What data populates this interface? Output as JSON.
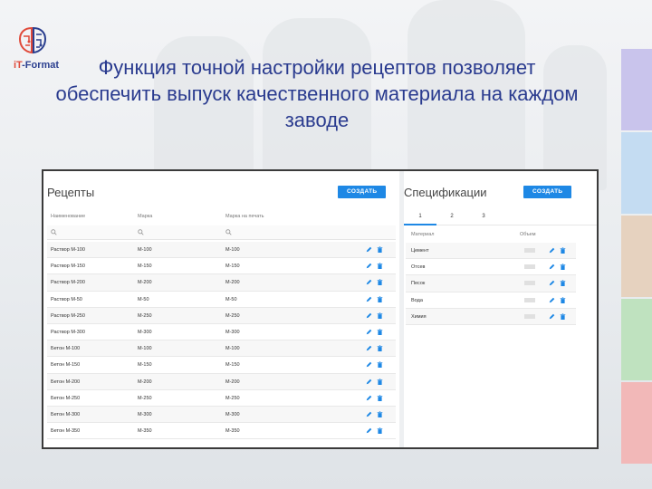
{
  "brand": {
    "logo_text_it": "iT",
    "logo_text_rest": "-Format"
  },
  "headline": "Функция точной настройки рецептов позволяет обеспечить выпуск качественного материала на каждом заводе",
  "side_bar_colors": [
    "#c9c4ec",
    "#c4dcf2",
    "#e6d2bf",
    "#bfe2bf",
    "#f2b8b8"
  ],
  "recipes": {
    "title": "Рецепты",
    "create_label": "СОЗДАТЬ",
    "columns": [
      "Наименование",
      "Марка",
      "Марка на печать"
    ],
    "rows": [
      [
        "Раствор М-100",
        "М-100",
        "М-100"
      ],
      [
        "Раствор М-150",
        "М-150",
        "М-150"
      ],
      [
        "Раствор М-200",
        "М-200",
        "М-200"
      ],
      [
        "Раствор М-50",
        "М-50",
        "М-50"
      ],
      [
        "Раствор М-250",
        "М-250",
        "М-250"
      ],
      [
        "Раствор М-300",
        "М-300",
        "М-300"
      ],
      [
        "Бетон М-100",
        "М-100",
        "М-100"
      ],
      [
        "Бетон М-150",
        "М-150",
        "М-150"
      ],
      [
        "Бетон М-200",
        "М-200",
        "М-200"
      ],
      [
        "Бетон М-250",
        "М-250",
        "М-250"
      ],
      [
        "Бетон М-300",
        "М-300",
        "М-300"
      ],
      [
        "Бетон М-350",
        "М-350",
        "М-350"
      ]
    ]
  },
  "specs": {
    "title": "Спецификации",
    "create_label": "СОЗДАТЬ",
    "tabs": [
      "1",
      "2",
      "3"
    ],
    "active_tab": "1",
    "columns": [
      "Материал",
      "Объем"
    ],
    "rows": [
      "Цемент",
      "Отсев",
      "Песок",
      "Вода",
      "Химия"
    ]
  },
  "colors": {
    "accent": "#1e88e5",
    "edit_icon": "#1e88e5",
    "delete_icon": "#1e88e5"
  }
}
